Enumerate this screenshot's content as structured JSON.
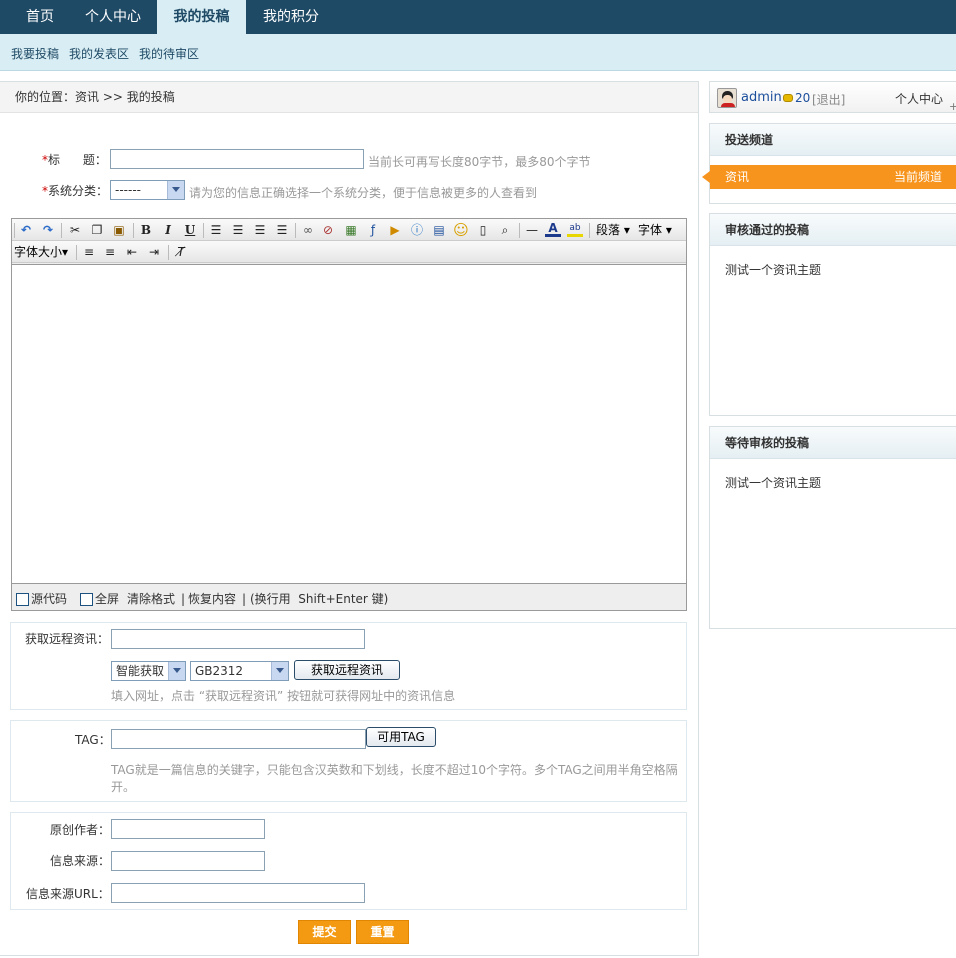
{
  "topnav": {
    "tabs": [
      {
        "label": "首页"
      },
      {
        "label": "个人中心"
      },
      {
        "label": "我的投稿"
      },
      {
        "label": "我的积分"
      }
    ]
  },
  "subnav": {
    "links": [
      {
        "label": "我要投稿"
      },
      {
        "label": "我的发表区"
      },
      {
        "label": "我的待审区"
      }
    ]
  },
  "breadcrumb": "你的位置：资讯  >> 我的投稿",
  "form": {
    "title_label_star": "*",
    "title_label": "标      题：",
    "title_value": "",
    "title_hint": "当前长可再写长度80字节，最多80个字节",
    "category_label": "系统分类：",
    "category_value": "------",
    "category_hint": "请为您的信息正确选择一个系统分类，便于信息被更多的人查看到"
  },
  "editor": {
    "toolbar_paragraph": "段落",
    "toolbar_font": "字体",
    "toolbar_fontsize": "字体大小",
    "footer_source": "源代码",
    "footer_fullscreen": "全屏",
    "footer_clear": "清除格式",
    "footer_restore": "恢复内容",
    "footer_tip": "(换行用  Shift+Enter 键)"
  },
  "remote": {
    "label": "获取远程资讯：",
    "url_value": "",
    "mode_value": "智能获取",
    "encoding_value": "GB2312",
    "button": "获取远程资讯",
    "hint": "填入网址，点击 “获取远程资讯” 按钮就可获得网址中的资讯信息"
  },
  "tag": {
    "label": "TAG：",
    "value": "",
    "button": "可用TAG",
    "hint": "TAG就是一篇信息的关键字，只能包含汉英数和下划线，长度不超过10个字符。多个TAG之间用半角空格隔开。"
  },
  "meta": {
    "author_label": "原创作者：",
    "source_label": "信息来源：",
    "source_url_label": "信息来源URL："
  },
  "actions": {
    "submit": "提交",
    "reset": "重置"
  },
  "sidebar": {
    "username": "admin",
    "points": "20",
    "logout": "[退出]",
    "user_center": "个人中心",
    "channel_header": "投送频道",
    "channel_name": "资讯",
    "channel_current": "当前频道",
    "approved_header": "审核通过的投稿",
    "approved_items": [
      "测试一个资讯主题"
    ],
    "pending_header": "等待审核的投稿",
    "pending_items": [
      "测试一个资讯主题"
    ]
  },
  "colors": {
    "nav_bg": "#1f4a66",
    "subnav_bg": "#d9eef4",
    "accent_orange": "#f7941d"
  }
}
